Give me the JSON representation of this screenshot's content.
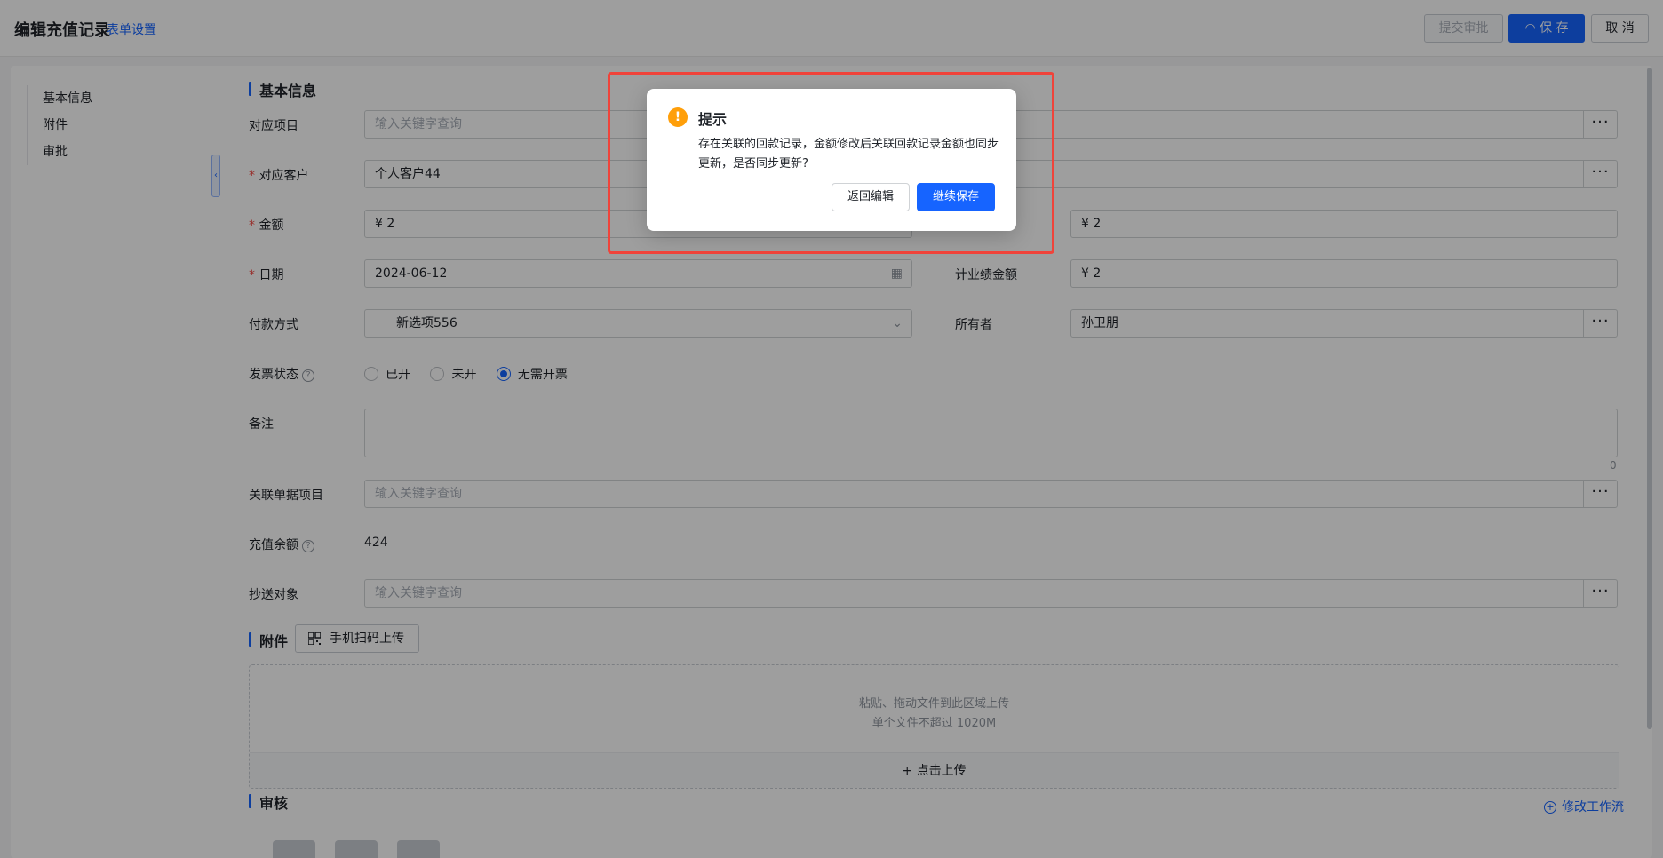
{
  "header": {
    "title": "编辑充值记录",
    "form_settings": "表单设置",
    "submit_label": "提交审批",
    "save_label": "保 存",
    "cancel_label": "取 消"
  },
  "side_nav": {
    "items": [
      {
        "label": "基本信息"
      },
      {
        "label": "附件"
      },
      {
        "label": "审批"
      }
    ]
  },
  "basic": {
    "section_title": "基本信息",
    "project": {
      "label": "对应项目",
      "placeholder": "输入关键字查询"
    },
    "customer": {
      "label": "对应客户",
      "value": "个人客户44"
    },
    "amount": {
      "label": "金额",
      "value": "¥ 2"
    },
    "amount_right": {
      "value": "¥ 2"
    },
    "date": {
      "label": "日期",
      "value": "2024-06-12"
    },
    "performance_amount": {
      "label": "计业绩金额",
      "value": "¥ 2"
    },
    "payment_method": {
      "label": "付款方式",
      "value": "新选项556"
    },
    "owner": {
      "label": "所有者",
      "value": "孙卫朋"
    },
    "invoice_status": {
      "label": "发票状态",
      "options": [
        "已开",
        "未开",
        "无需开票"
      ],
      "selected": "无需开票"
    },
    "remark": {
      "label": "备注",
      "counter": "0"
    },
    "related_project": {
      "label": "关联单据项目",
      "placeholder": "输入关键字查询"
    },
    "balance": {
      "label": "充值余额",
      "value": "424"
    },
    "cc": {
      "label": "抄送对象",
      "placeholder": "输入关键字查询"
    }
  },
  "attachment": {
    "section_title": "附件",
    "qr_upload": "手机扫码上传",
    "drop_hint": "粘贴、拖动文件到此区域上传",
    "size_hint": "单个文件不超过 1020M",
    "upload_label": "点击上传"
  },
  "approval": {
    "section_title": "审核",
    "edit_flow": "修改工作流"
  },
  "dialog": {
    "title": "提示",
    "message": "存在关联的回款记录，金额修改后关联回款记录金额也同步更新，是否同步更新?",
    "back_label": "返回编辑",
    "continue_label": "继续保存"
  },
  "colors": {
    "accent": "#1664ff",
    "warning": "#ff9f0a",
    "highlight": "#f0433a",
    "required": "#f54a45"
  }
}
